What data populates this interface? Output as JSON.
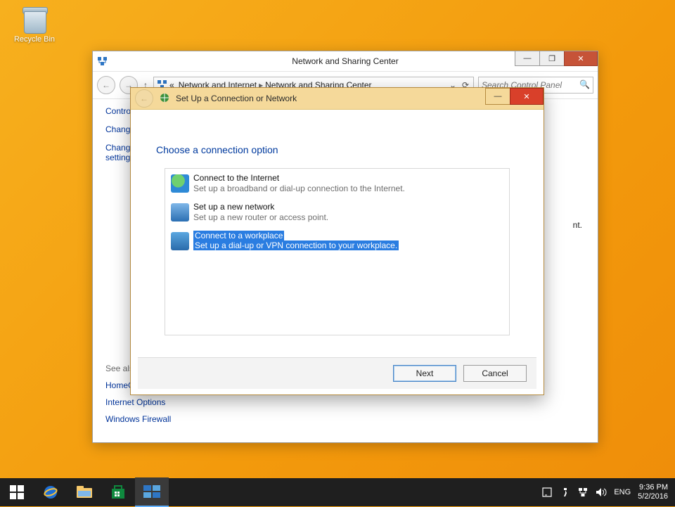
{
  "desktop": {
    "recycle_bin": "Recycle Bin"
  },
  "window": {
    "title": "Network and Sharing Center",
    "breadcrumb": {
      "level1": "Network and Internet",
      "level2": "Network and Sharing Center"
    },
    "search_placeholder": "Search Control Panel",
    "sidebar": {
      "items": [
        {
          "label": "Control Panel Home"
        },
        {
          "label": "Change adapter settings"
        },
        {
          "label": "Change advanced sharing settings"
        }
      ]
    },
    "see_also": {
      "heading": "See also",
      "links": [
        "HomeGroup",
        "Internet Options",
        "Windows Firewall"
      ]
    },
    "stray_text": "nt."
  },
  "wizard": {
    "title": "Set Up a Connection or Network",
    "heading": "Choose a connection option",
    "options": [
      {
        "title": "Connect to the Internet",
        "sub": "Set up a broadband or dial-up connection to the Internet.",
        "selected": false
      },
      {
        "title": "Set up a new network",
        "sub": "Set up a new router or access point.",
        "selected": false
      },
      {
        "title": "Connect to a workplace",
        "sub": "Set up a dial-up or VPN connection to your workplace.",
        "selected": true
      }
    ],
    "buttons": {
      "next": "Next",
      "cancel": "Cancel"
    }
  },
  "taskbar": {
    "lang": "ENG",
    "time": "9:36 PM",
    "date": "5/2/2016"
  }
}
